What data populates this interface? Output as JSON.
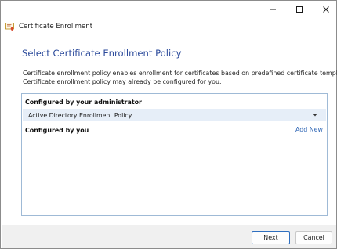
{
  "window": {
    "title": "Certificate Enrollment",
    "controls": {
      "minimize": "minimize-icon",
      "maximize": "maximize-icon",
      "close": "close-icon"
    }
  },
  "page": {
    "title": "Select Certificate Enrollment Policy",
    "description_lines": [
      "Certificate enrollment policy enables enrollment for certificates based on predefined certificate templates.",
      "Certificate enrollment policy may already be configured for you."
    ]
  },
  "policy_panel": {
    "admin_heading": "Configured by your administrator",
    "admin_policy": "Active Directory Enrollment Policy",
    "user_heading": "Configured by you",
    "add_new_label": "Add New"
  },
  "footer": {
    "next_label": "Next",
    "cancel_label": "Cancel"
  },
  "colors": {
    "title_blue": "#2b4a9b",
    "link_blue": "#2d65b5",
    "selected_row": "#e6eef8",
    "panel_border": "#9fbad6"
  }
}
